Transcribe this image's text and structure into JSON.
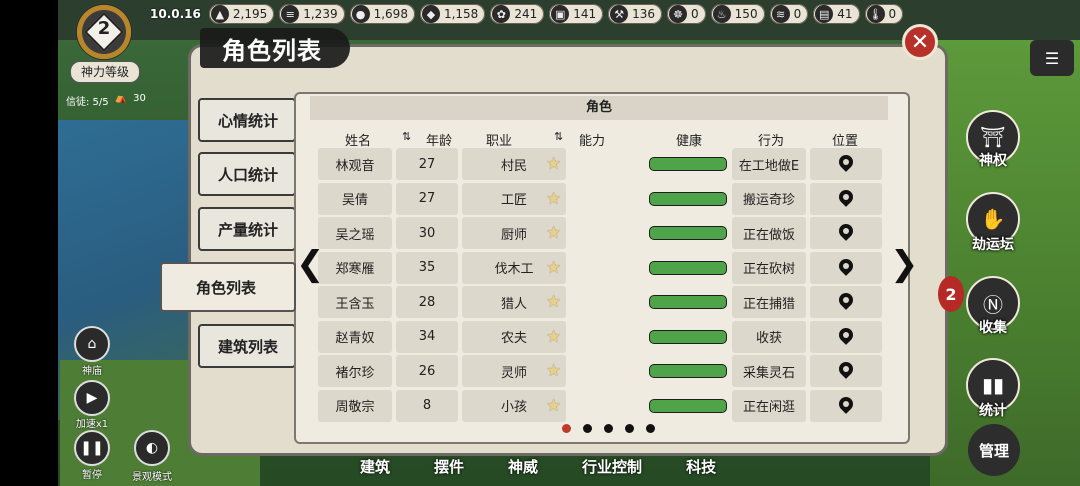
{
  "version": "10.0.16",
  "resources": [
    {
      "icon": "mountain-icon",
      "value": "2,195"
    },
    {
      "icon": "wood-icon",
      "value": "1,239"
    },
    {
      "icon": "stone-icon",
      "value": "1,698"
    },
    {
      "icon": "ore-icon",
      "value": "1,158"
    },
    {
      "icon": "herb-icon",
      "value": "241"
    },
    {
      "icon": "cloth-icon",
      "value": "141"
    },
    {
      "icon": "tool-icon",
      "value": "136"
    },
    {
      "icon": "food-icon",
      "value": "0"
    },
    {
      "icon": "meat-icon",
      "value": "150"
    },
    {
      "icon": "incense-icon",
      "value": "0"
    },
    {
      "icon": "chest-icon",
      "value": "41"
    },
    {
      "icon": "thermometer-icon",
      "value": "0"
    }
  ],
  "god": {
    "level": "2",
    "label": "神力等级",
    "believers": "信徒: 5/5",
    "tents": "30"
  },
  "title": "角色列表",
  "tabs": [
    {
      "label": "心情统计"
    },
    {
      "label": "人口统计"
    },
    {
      "label": "产量统计"
    },
    {
      "label": "角色列表"
    },
    {
      "label": "建筑列表"
    }
  ],
  "table": {
    "header": "角色",
    "columns": {
      "name": "姓名",
      "age": "年龄",
      "job": "职业",
      "ability": "能力",
      "health": "健康",
      "action": "行为",
      "location": "位置"
    },
    "rows": [
      {
        "name": "林观音",
        "age": "27",
        "job": "村民",
        "action": "在工地做E",
        "health": 1.0
      },
      {
        "name": "吴倩",
        "age": "27",
        "job": "工匠",
        "action": "搬运奇珍",
        "health": 1.0
      },
      {
        "name": "吴之瑶",
        "age": "30",
        "job": "厨师",
        "action": "正在做饭",
        "health": 1.0
      },
      {
        "name": "郑寒雁",
        "age": "35",
        "job": "伐木工",
        "action": "正在砍树",
        "health": 1.0
      },
      {
        "name": "王含玉",
        "age": "28",
        "job": "猎人",
        "action": "正在捕猎",
        "health": 1.0
      },
      {
        "name": "赵青奴",
        "age": "34",
        "job": "农夫",
        "action": "收获",
        "health": 1.0
      },
      {
        "name": "褚尔珍",
        "age": "26",
        "job": "灵师",
        "action": "采集灵石",
        "health": 1.0
      },
      {
        "name": "周敬宗",
        "age": "8",
        "job": "小孩",
        "action": "正在闲逛",
        "health": 1.0
      }
    ]
  },
  "pagination": {
    "pages": 5,
    "current": 1
  },
  "right_buttons": [
    {
      "label": "神权",
      "icon": "temple-icon"
    },
    {
      "label": "劫运坛",
      "icon": "altar-icon"
    },
    {
      "label": "收集",
      "icon": "collect-icon"
    },
    {
      "label": "统计",
      "icon": "stats-icon"
    }
  ],
  "manage_label": "管理",
  "left_buttons": [
    {
      "label": "神庙",
      "icon": "shrine-icon"
    },
    {
      "label": "加速x1",
      "icon": "play-icon"
    },
    {
      "label": "暂停",
      "icon": "pause-icon"
    },
    {
      "label": "景观模式",
      "icon": "landscape-icon"
    }
  ],
  "bottom_tabs": [
    "建筑",
    "摆件",
    "神威",
    "行业控制",
    "科技"
  ]
}
